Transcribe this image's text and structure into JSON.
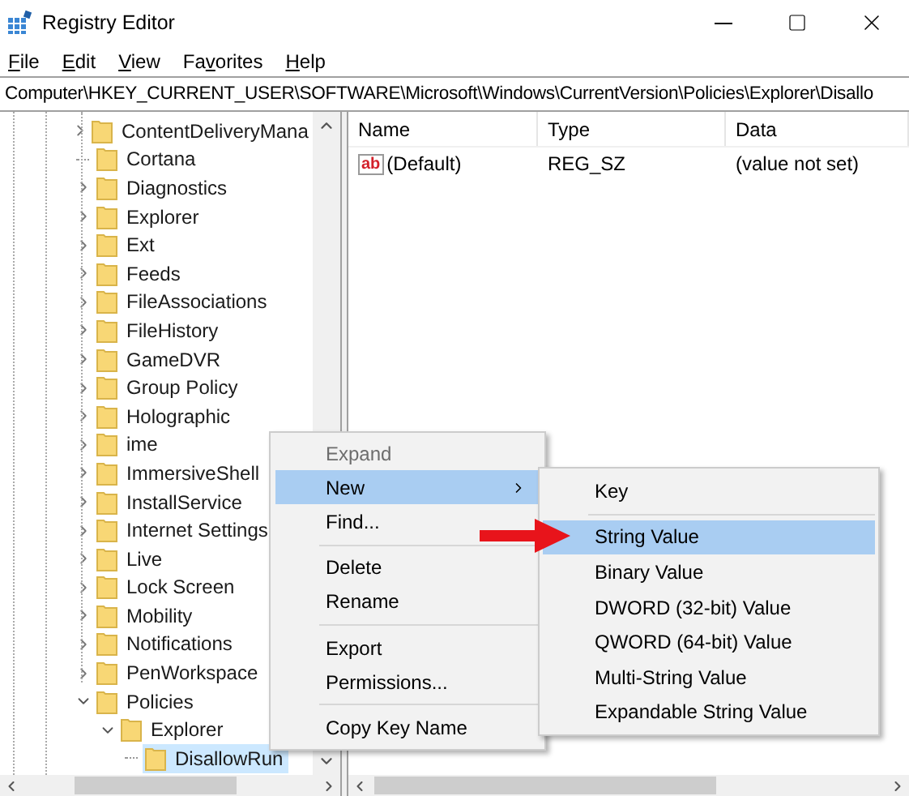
{
  "window": {
    "title": "Registry Editor"
  },
  "menu": [
    {
      "accel": "F",
      "after": "ile"
    },
    {
      "accel": "E",
      "after": "dit"
    },
    {
      "accel": "V",
      "after": "iew"
    },
    {
      "before": "Fa",
      "accel": "v",
      "after": "orites"
    },
    {
      "accel": "H",
      "after": "elp"
    }
  ],
  "address": "Computer\\HKEY_CURRENT_USER\\SOFTWARE\\Microsoft\\Windows\\CurrentVersion\\Policies\\Explorer\\Disallo",
  "tree": [
    {
      "label": "ContentDeliveryMana",
      "kind": "branch",
      "expanded": false,
      "selected": false
    },
    {
      "label": "Cortana",
      "kind": "leaf",
      "selected": false
    },
    {
      "label": "Diagnostics",
      "kind": "branch",
      "expanded": false,
      "selected": false
    },
    {
      "label": "Explorer",
      "kind": "branch",
      "expanded": false,
      "selected": false
    },
    {
      "label": "Ext",
      "kind": "branch",
      "expanded": false,
      "selected": false
    },
    {
      "label": "Feeds",
      "kind": "branch",
      "expanded": false,
      "selected": false
    },
    {
      "label": "FileAssociations",
      "kind": "branch",
      "expanded": false,
      "selected": false
    },
    {
      "label": "FileHistory",
      "kind": "branch",
      "expanded": false,
      "selected": false
    },
    {
      "label": "GameDVR",
      "kind": "branch",
      "expanded": false,
      "selected": false
    },
    {
      "label": "Group Policy",
      "kind": "branch",
      "expanded": false,
      "selected": false
    },
    {
      "label": "Holographic",
      "kind": "branch",
      "expanded": false,
      "selected": false
    },
    {
      "label": "ime",
      "kind": "branch",
      "expanded": false,
      "selected": false
    },
    {
      "label": "ImmersiveShell",
      "kind": "branch",
      "expanded": false,
      "selected": false
    },
    {
      "label": "InstallService",
      "kind": "branch",
      "expanded": false,
      "selected": false
    },
    {
      "label": "Internet Settings",
      "kind": "branch",
      "expanded": false,
      "selected": false
    },
    {
      "label": "Live",
      "kind": "branch",
      "expanded": false,
      "selected": false
    },
    {
      "label": "Lock Screen",
      "kind": "branch",
      "expanded": false,
      "selected": false
    },
    {
      "label": "Mobility",
      "kind": "branch",
      "expanded": false,
      "selected": false
    },
    {
      "label": "Notifications",
      "kind": "branch",
      "expanded": false,
      "selected": false
    },
    {
      "label": "PenWorkspace",
      "kind": "branch",
      "expanded": false,
      "selected": false
    },
    {
      "label": "Policies",
      "kind": "branch",
      "expanded": true,
      "selected": false,
      "children": [
        {
          "label": "Explorer",
          "kind": "branch",
          "expanded": true,
          "selected": false,
          "children": [
            {
              "label": "DisallowRun",
              "kind": "leaf",
              "selected": true
            }
          ]
        }
      ]
    }
  ],
  "values": {
    "columns": [
      "Name",
      "Type",
      "Data"
    ],
    "rows": [
      {
        "type_glyph": "ab",
        "name": "(Default)",
        "type": "REG_SZ",
        "data": "(value not set)"
      }
    ]
  },
  "context_menu": {
    "groups": [
      [
        {
          "label": "Expand",
          "disabled": true,
          "selected": false,
          "submenu": false
        },
        {
          "label": "New",
          "disabled": false,
          "selected": true,
          "submenu": true
        },
        {
          "label": "Find...",
          "disabled": false,
          "selected": false,
          "submenu": false
        }
      ],
      [
        {
          "label": "Delete",
          "disabled": false,
          "selected": false,
          "submenu": false
        },
        {
          "label": "Rename",
          "disabled": false,
          "selected": false,
          "submenu": false
        }
      ],
      [
        {
          "label": "Export",
          "disabled": false,
          "selected": false,
          "submenu": false
        },
        {
          "label": "Permissions...",
          "disabled": false,
          "selected": false,
          "submenu": false
        }
      ],
      [
        {
          "label": "Copy Key Name",
          "disabled": false,
          "selected": false,
          "submenu": false
        }
      ]
    ]
  },
  "submenu": {
    "groups": [
      [
        {
          "label": "Key",
          "selected": false
        }
      ],
      [
        {
          "label": "String Value",
          "selected": true
        },
        {
          "label": "Binary Value",
          "selected": false
        },
        {
          "label": "DWORD (32-bit) Value",
          "selected": false
        },
        {
          "label": "QWORD (64-bit) Value",
          "selected": false
        },
        {
          "label": "Multi-String Value",
          "selected": false
        },
        {
          "label": "Expandable String Value",
          "selected": false
        }
      ]
    ]
  }
}
